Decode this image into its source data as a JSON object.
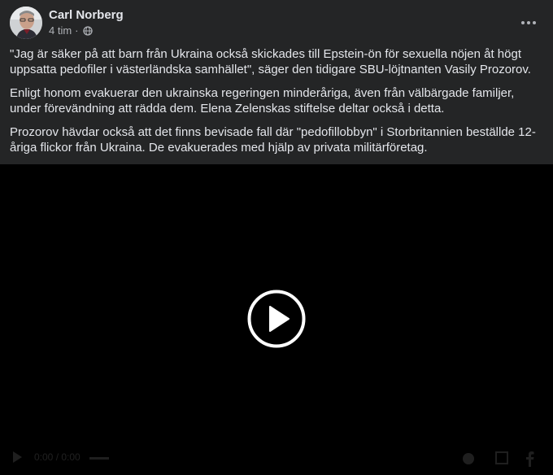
{
  "post": {
    "author": "Carl Norberg",
    "timestamp": "4 tim",
    "separator": "·",
    "privacy_icon": "globe-icon",
    "more_icon": "more-options-icon",
    "paragraphs": [
      "\"Jag är säker på att barn från Ukraina också skickades till Epstein-ön för sexuella nöjen åt högt uppsatta pedofiler i västerländska samhället\", säger den tidigare SBU-löjtnanten Vasily Prozorov.",
      "Enligt honom evakuerar den ukrainska regeringen minderåriga, även från välbärgade familjer, under förevändning att rädda dem. Elena Zelenskas stiftelse deltar också i detta.",
      "Prozorov hävdar också att det finns bevisade fall där \"pedofillobbyn\" i Storbritannien beställde 12-åriga flickor från Ukraina. De evakuerades med hjälp av privata militärföretag."
    ]
  },
  "video": {
    "play_icon": "play-icon",
    "controls": {
      "time": "0:00 / 0:00",
      "icons": [
        "play-small-icon",
        "volume-icon",
        "settings-icon",
        "fullscreen-icon",
        "facebook-icon"
      ]
    }
  },
  "colors": {
    "card_bg": "#242526",
    "text_primary": "#e4e6eb",
    "text_secondary": "#b0b3b8",
    "video_bg": "#000000"
  }
}
